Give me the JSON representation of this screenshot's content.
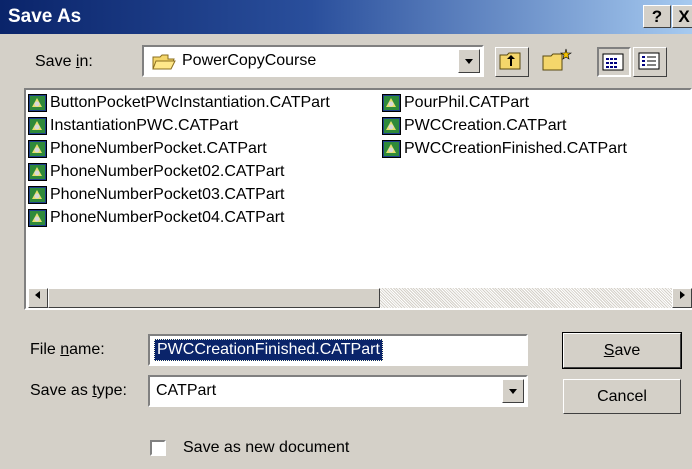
{
  "window": {
    "title": "Save As",
    "help_button": "?",
    "close_button": "X"
  },
  "save_in": {
    "label_pre": "Save ",
    "label_u": "i",
    "label_post": "n:",
    "value": "PowerCopyCourse"
  },
  "toolbar": {
    "icons": [
      "up-one-level-icon",
      "create-new-folder-icon",
      "list-view-icon",
      "details-view-icon"
    ]
  },
  "files": {
    "column1": [
      "ButtonPocketPWcInstantiation.CATPart",
      "InstantiationPWC.CATPart",
      "PhoneNumberPocket.CATPart",
      "PhoneNumberPocket02.CATPart",
      "PhoneNumberPocket03.CATPart",
      "PhoneNumberPocket04.CATPart"
    ],
    "column2": [
      "PourPhil.CATPart",
      "PWCCreation.CATPart",
      "PWCCreationFinished.CATPart"
    ]
  },
  "file_name": {
    "label_pre": "File ",
    "label_u": "n",
    "label_post": "ame:",
    "value": "PWCCreationFinished.CATPart"
  },
  "save_as_type": {
    "label_pre": "Save as ",
    "label_u": "t",
    "label_post": "ype:",
    "value": "CATPart"
  },
  "buttons": {
    "save_u": "S",
    "save_rest": "ave",
    "cancel": "Cancel"
  },
  "new_document": {
    "label": "Save as new document",
    "checked": false
  },
  "colors": {
    "title_start": "#0a246a",
    "title_end": "#a6caf0",
    "face": "#d4d0c8",
    "selection": "#0a246a"
  }
}
